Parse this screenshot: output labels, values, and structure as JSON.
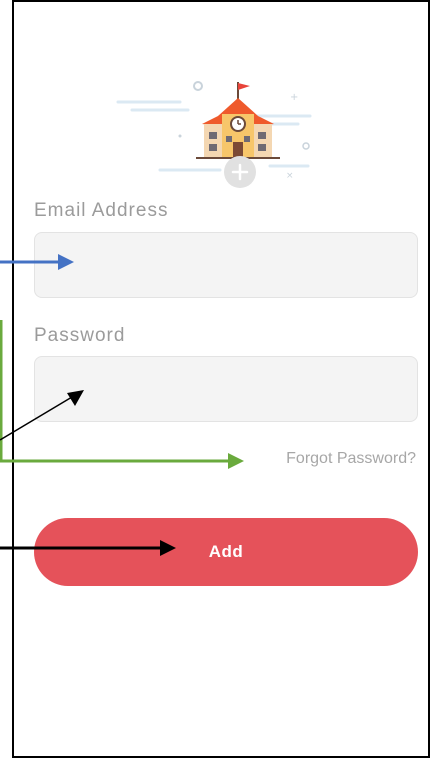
{
  "form": {
    "email_label": "Email Address",
    "email_value": "",
    "password_label": "Password",
    "password_value": "",
    "forgot_label": "Forgot Password?",
    "add_label": "Add"
  },
  "icons": {
    "school": "school-building-icon",
    "plus": "plus-badge-icon"
  },
  "colors": {
    "accent_button": "#e5525a",
    "arrow_blue": "#4472c4",
    "arrow_green": "#6aaa3d",
    "arrow_black": "#000000"
  }
}
